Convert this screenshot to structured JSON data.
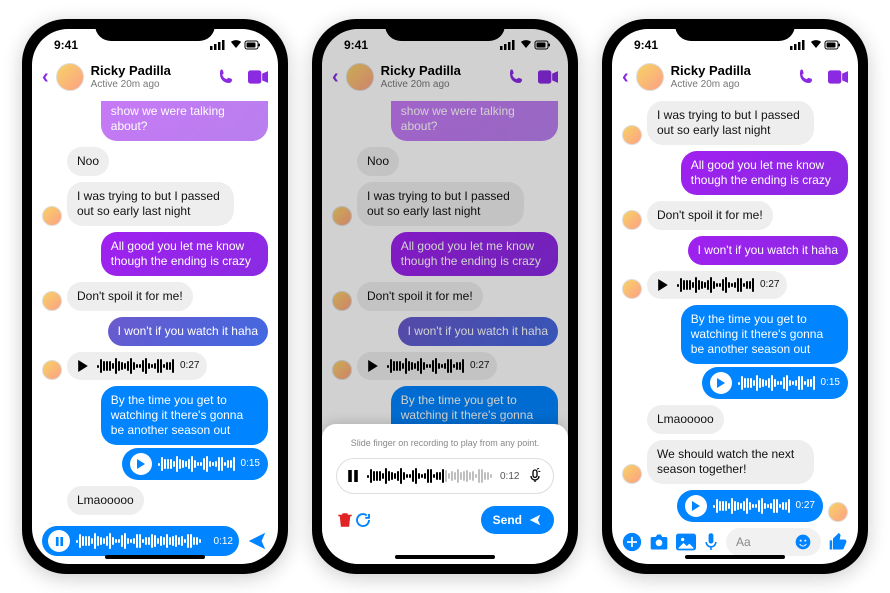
{
  "status_time": "9:41",
  "header": {
    "name": "Ricky Padilla",
    "status": "Active 20m ago"
  },
  "messages": {
    "peek": "show we were talking about?",
    "noo": "Noo",
    "passed_out": "I was trying to but I passed out so early last night",
    "all_good": "All good you let me know though the ending is crazy",
    "dont_spoil": "Don't spoil it for me!",
    "wont_if": "I won't if you watch it haha",
    "voice_in_time": "0:27",
    "by_the_time": "By the time you get to watching it there's gonna be another season out",
    "voice_out_time": "0:15",
    "lmao": "Lmaooooo",
    "watch_together": "We should watch the next season together!",
    "voice_out2_time": "0:27"
  },
  "recorder": {
    "pill_time": "0:12",
    "hint": "Slide finger on recording to play from any point.",
    "box_time": "0:12",
    "send_label": "Send"
  },
  "composer": {
    "placeholder": "Aa"
  }
}
